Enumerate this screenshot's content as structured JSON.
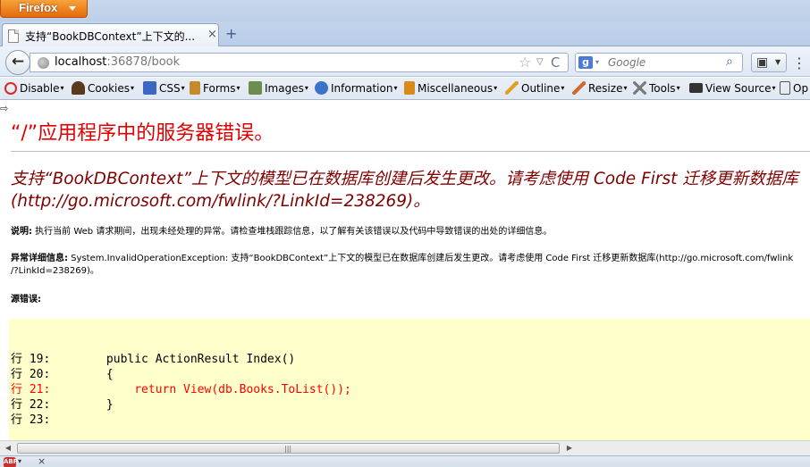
{
  "app": {
    "menu_button": "Firefox"
  },
  "tab": {
    "title": "支持“BookDBContext”上下文的...",
    "close": "×",
    "new_tab": "+"
  },
  "navbar": {
    "back": "←",
    "url_host": "localhost",
    "url_port_path": ":36878/book",
    "star": "☆",
    "dropmarker": "▽",
    "reload": "C",
    "search_engine": "g",
    "search_placeholder": "Google",
    "search_go": "⌕",
    "bookmarks_icon": "▣",
    "menu_icon": "⋮"
  },
  "devtoolbar": {
    "items": [
      {
        "label": "Disable",
        "icon": "disable-icon",
        "color": "#d62b1f"
      },
      {
        "label": "Cookies",
        "icon": "cookies-icon",
        "color": "#5a3a1a"
      },
      {
        "label": "CSS",
        "icon": "css-icon",
        "color": "#3b66c4"
      },
      {
        "label": "Forms",
        "icon": "forms-icon",
        "color": "#c58a2e"
      },
      {
        "label": "Images",
        "icon": "images-icon",
        "color": "#6b8e4e"
      },
      {
        "label": "Information",
        "icon": "information-icon",
        "color": "#3a73c9"
      },
      {
        "label": "Miscellaneous",
        "icon": "miscellaneous-icon",
        "color": "#d98a1c"
      },
      {
        "label": "Outline",
        "icon": "outline-icon",
        "color": "#e0a020"
      },
      {
        "label": "Resize",
        "icon": "resize-icon",
        "color": "#d06a2a"
      },
      {
        "label": "Tools",
        "icon": "tools-icon",
        "color": "#7a7a7a"
      },
      {
        "label": "View Source",
        "icon": "view-source-icon",
        "color": "#333333"
      },
      {
        "label": "Op",
        "icon": "options-icon",
        "color": "#555555"
      }
    ]
  },
  "page": {
    "cursor_mark": "⇨",
    "error_heading": "“/”应用程序中的服务器错误。",
    "error_message": "支持“BookDBContext”上下文的模型已在数据库创建后发生更改。请考虑使用 Code First 迁移更新数据库 (http://go.microsoft.com/fwlink/?LinkId=238269)。",
    "description_label": "说明:",
    "description_text": " 执行当前 Web 请求期间，出现未经处理的异常。请检查堆栈跟踪信息，以了解有关该错误以及代码中导致错误的出处的详细信息。",
    "exception_label": "异常详细信息:",
    "exception_text": " System.InvalidOperationException: 支持“BookDBContext”上下文的模型已在数据库创建后发生更改。请考虑使用 Code First 迁移更新数据库(http://go.microsoft.com/fwlink",
    "exception_text_2": "/?LinkId=238269)。",
    "source_error_label": "源错误:",
    "code_lines": [
      {
        "text": "行 19:        public ActionResult Index()",
        "error": false
      },
      {
        "text": "行 20:        {",
        "error": false
      },
      {
        "text": "行 21:            return View(db.Books.ToList());",
        "error": true
      },
      {
        "text": "行 22:        }",
        "error": false
      },
      {
        "text": "行 23:",
        "error": false
      }
    ],
    "colors": {
      "heading": "#e00000",
      "message": "#800000",
      "code_bg": "#ffffcc",
      "error_line": "#ff0000"
    }
  },
  "scrollbar": {
    "left_arrow": "◀",
    "grip": "|||",
    "right_arrow": "▶"
  },
  "addonbar": {
    "abp": "ABP",
    "dropdown": "▾",
    "close": "×"
  }
}
